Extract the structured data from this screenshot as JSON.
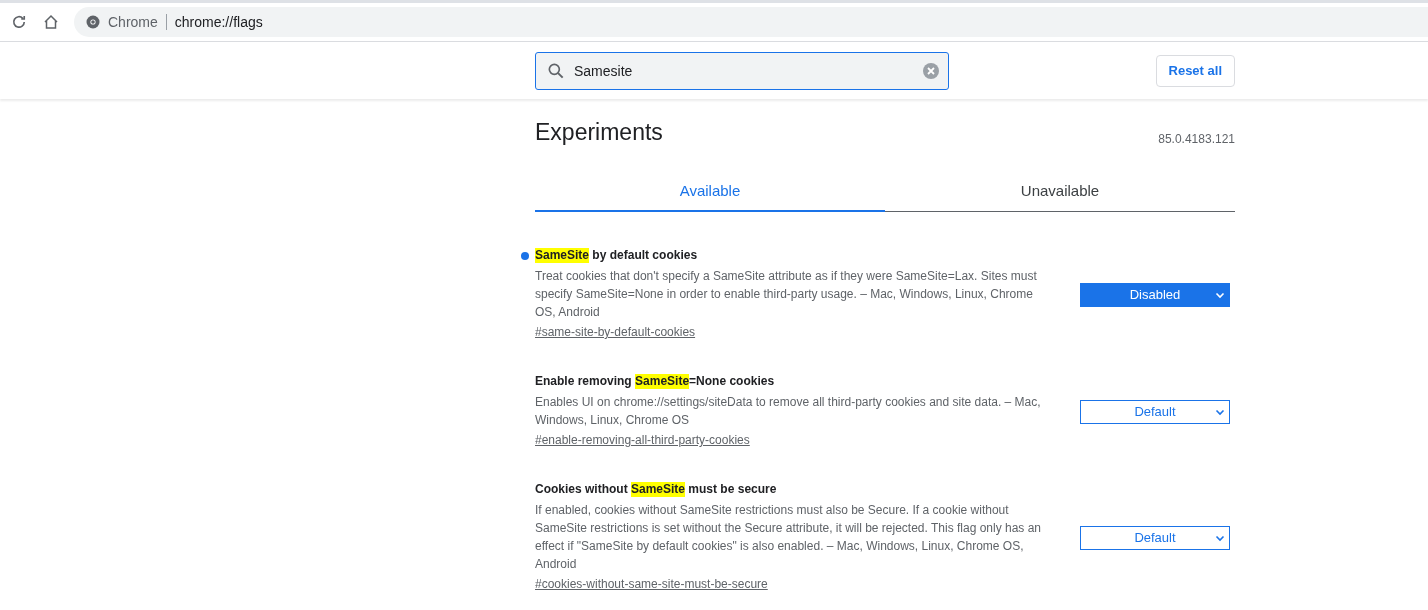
{
  "browser": {
    "site": "Chrome",
    "url": "chrome://flags"
  },
  "search": {
    "value": "Samesite"
  },
  "reset_button": "Reset all",
  "title": "Experiments",
  "version": "85.0.4183.121",
  "tabs": [
    {
      "label": "Available",
      "selected": true
    },
    {
      "label": "Unavailable",
      "selected": false
    }
  ],
  "flags": [
    {
      "title_match": "SameSite",
      "title_after": " by default cookies",
      "description": "Treat cookies that don't specify a SameSite attribute as if they were SameSite=Lax. Sites must specify SameSite=None in order to enable third-party usage. – Mac, Windows, Linux, Chrome OS, Android",
      "link": "#same-site-by-default-cookies",
      "value": "Disabled",
      "modified": true
    },
    {
      "title_before": "Enable removing ",
      "title_match": "SameSite",
      "title_after": "=None cookies",
      "description": "Enables UI on chrome://settings/siteData to remove all third-party cookies and site data. – Mac, Windows, Linux, Chrome OS",
      "link": "#enable-removing-all-third-party-cookies",
      "value": "Default",
      "modified": false
    },
    {
      "title_before": "Cookies without ",
      "title_match": "SameSite",
      "title_after": " must be secure",
      "description": "If enabled, cookies without SameSite restrictions must also be Secure. If a cookie without SameSite restrictions is set without the Secure attribute, it will be rejected. This flag only has an effect if \"SameSite by default cookies\" is also enabled. – Mac, Windows, Linux, Chrome OS, Android",
      "link": "#cookies-without-same-site-must-be-secure",
      "value": "Default",
      "modified": false
    }
  ]
}
